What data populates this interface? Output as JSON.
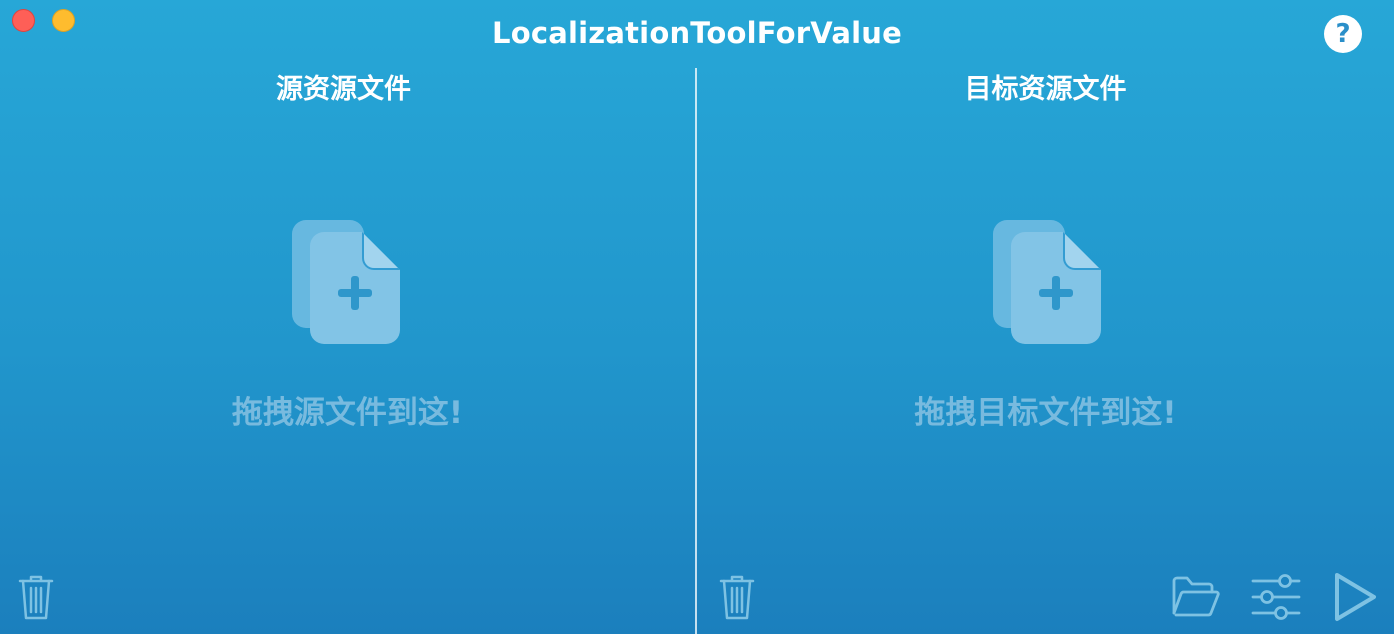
{
  "window": {
    "title": "LocalizationToolForValue",
    "help_label": "?"
  },
  "source_pane": {
    "title": "源资源文件",
    "drop_hint": "拖拽源文件到这!"
  },
  "target_pane": {
    "title": "目标资源文件",
    "drop_hint": "拖拽目标文件到这!"
  },
  "icons": {
    "close": "close-traffic-light",
    "minimize": "minimize-traffic-light",
    "help": "help-icon",
    "add_file": "add-file-icon",
    "trash": "trash-icon",
    "folder": "folder-open-icon",
    "settings": "sliders-icon",
    "run": "play-icon"
  },
  "colors": {
    "background_top": "#27a7d7",
    "background_bottom": "#1b7fbd",
    "close": "#fe5f57",
    "minimize": "#febc2e",
    "icon_light": "#7ec2e3"
  }
}
